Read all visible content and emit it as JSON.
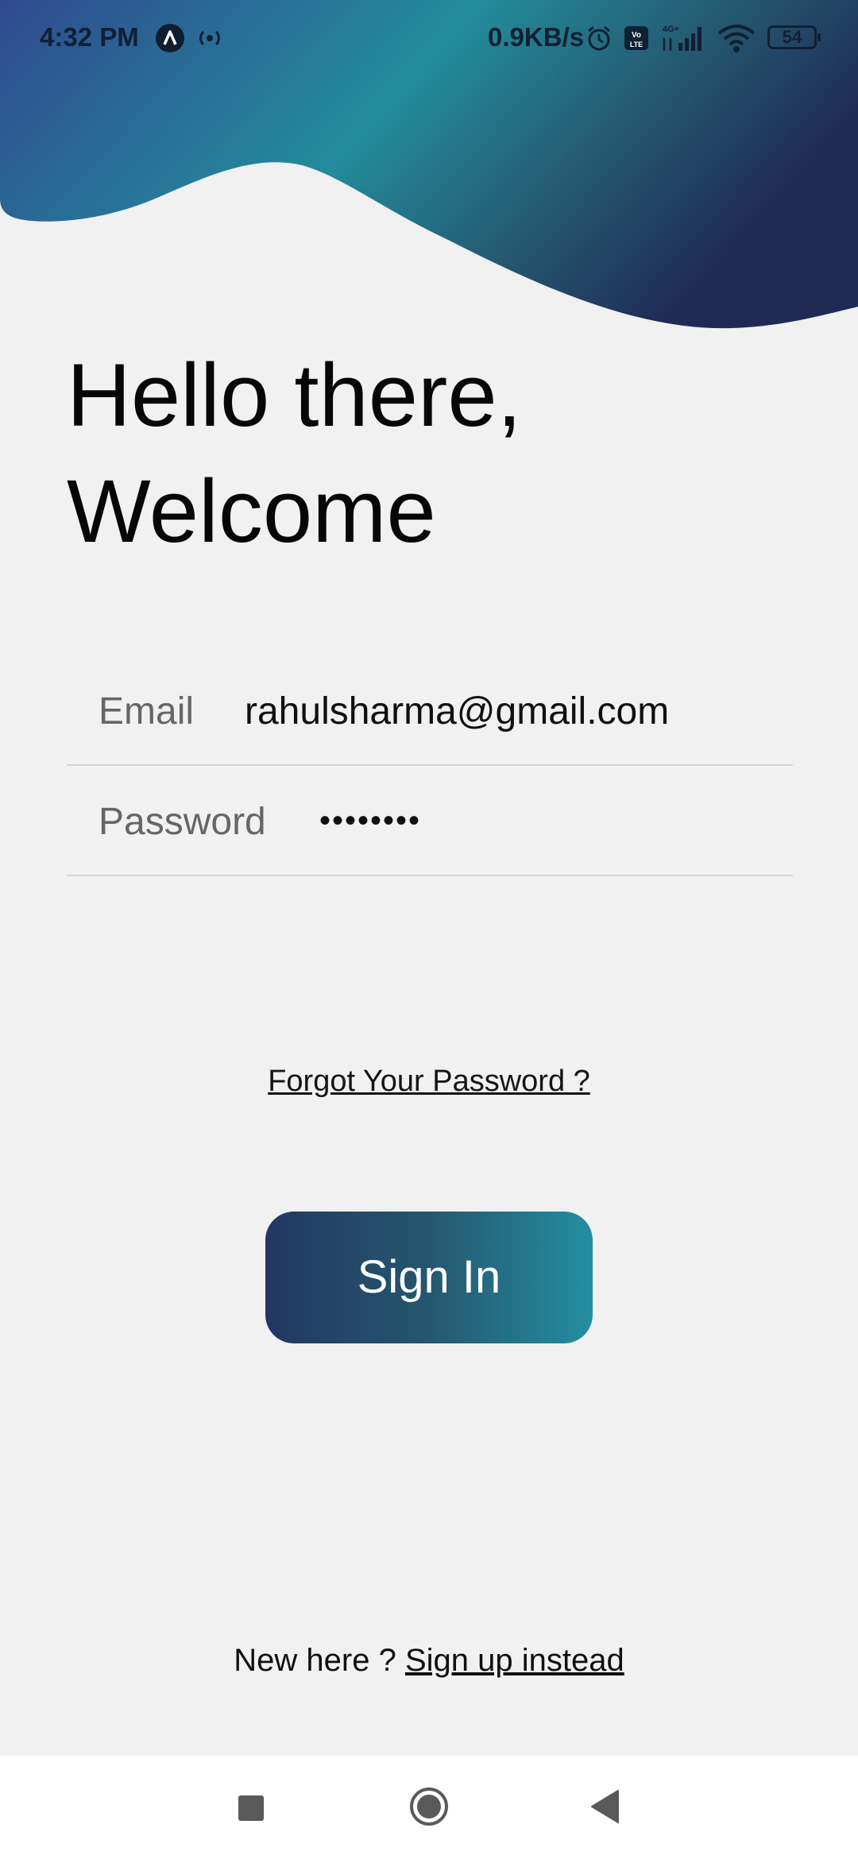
{
  "status_bar": {
    "time": "4:32 PM",
    "network_speed": "0.9KB/s",
    "battery_level": "54",
    "icons": [
      "app-icon",
      "hotspot-icon",
      "alarm-icon",
      "volte-icon",
      "signal-icon",
      "wifi-icon",
      "battery-icon"
    ]
  },
  "greeting": {
    "line1": "Hello there,",
    "line2": "Welcome"
  },
  "form": {
    "email_label": "Email",
    "email_value": "rahulsharma@gmail.com",
    "password_label": "Password",
    "password_value": "••••••••"
  },
  "forgot_password": "Forgot Your Password ?",
  "sign_in_label": "Sign In",
  "signup": {
    "prompt": "New here ? ",
    "link": "Sign up instead"
  },
  "nav": {
    "icons": [
      "recent-apps-icon",
      "home-icon",
      "back-icon"
    ]
  },
  "colors": {
    "background": "#f1f1f2",
    "gradient_start": "#2d4a8e",
    "gradient_mid": "#238c9c",
    "gradient_end": "#1f2d58",
    "button_start": "#223762",
    "button_end": "#248ea1"
  }
}
